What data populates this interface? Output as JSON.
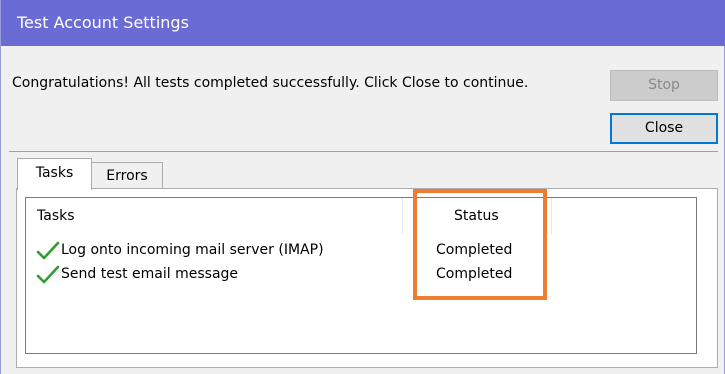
{
  "window": {
    "title": "Test Account Settings"
  },
  "message": "Congratulations! All tests completed successfully. Click Close to continue.",
  "buttons": {
    "stop_label": "Stop",
    "close_label": "Close"
  },
  "tabs": [
    {
      "label": "Tasks",
      "selected": true
    },
    {
      "label": "Errors",
      "selected": false
    }
  ],
  "task_list": {
    "columns": [
      "Tasks",
      "Status"
    ],
    "rows": [
      {
        "icon": "green-checkmark-icon",
        "task": "Log onto incoming mail server (IMAP)",
        "status": "Completed"
      },
      {
        "icon": "green-checkmark-icon",
        "task": "Send test email message",
        "status": "Completed"
      }
    ]
  },
  "colors": {
    "titlebar": "#6b6bd6",
    "check": "#2e9e2e",
    "highlight_box": "#ed7d31",
    "close_button_border": "#0078d7"
  }
}
